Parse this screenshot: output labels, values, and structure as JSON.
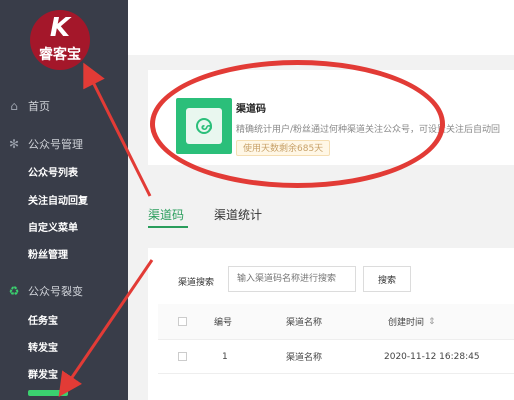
{
  "logo": {
    "glyph": "K",
    "text": "睿客宝"
  },
  "sidebar": {
    "home": "首页",
    "section1": "公众号管理",
    "section1_items": [
      "公众号列表",
      "关注自动回复",
      "自定义菜单",
      "粉丝管理"
    ],
    "section2": "公众号裂变",
    "section2_items": [
      "任务宝",
      "转发宝",
      "群发宝"
    ]
  },
  "card": {
    "title": "渠道码",
    "desc": "精确统计用户/粉丝通过何种渠道关注公众号，可设置关注后自动回",
    "badge": "使用天数剩余685天"
  },
  "tabs": [
    "渠道码",
    "渠道统计"
  ],
  "search": {
    "label": "渠道搜索",
    "placeholder": "输入渠道码名称进行搜索",
    "button": "搜索"
  },
  "table": {
    "headers": [
      "编号",
      "渠道名称",
      "创建时间"
    ],
    "sort_glyph": "⇕",
    "rows": [
      {
        "id": "1",
        "name": "渠道名称",
        "created": "2020-11-12 16:28:45"
      }
    ]
  },
  "colors": {
    "sidebar": "#393d49",
    "accent": "#2a9d5c",
    "annotation": "#e23b36",
    "logo": "#a4172a"
  }
}
